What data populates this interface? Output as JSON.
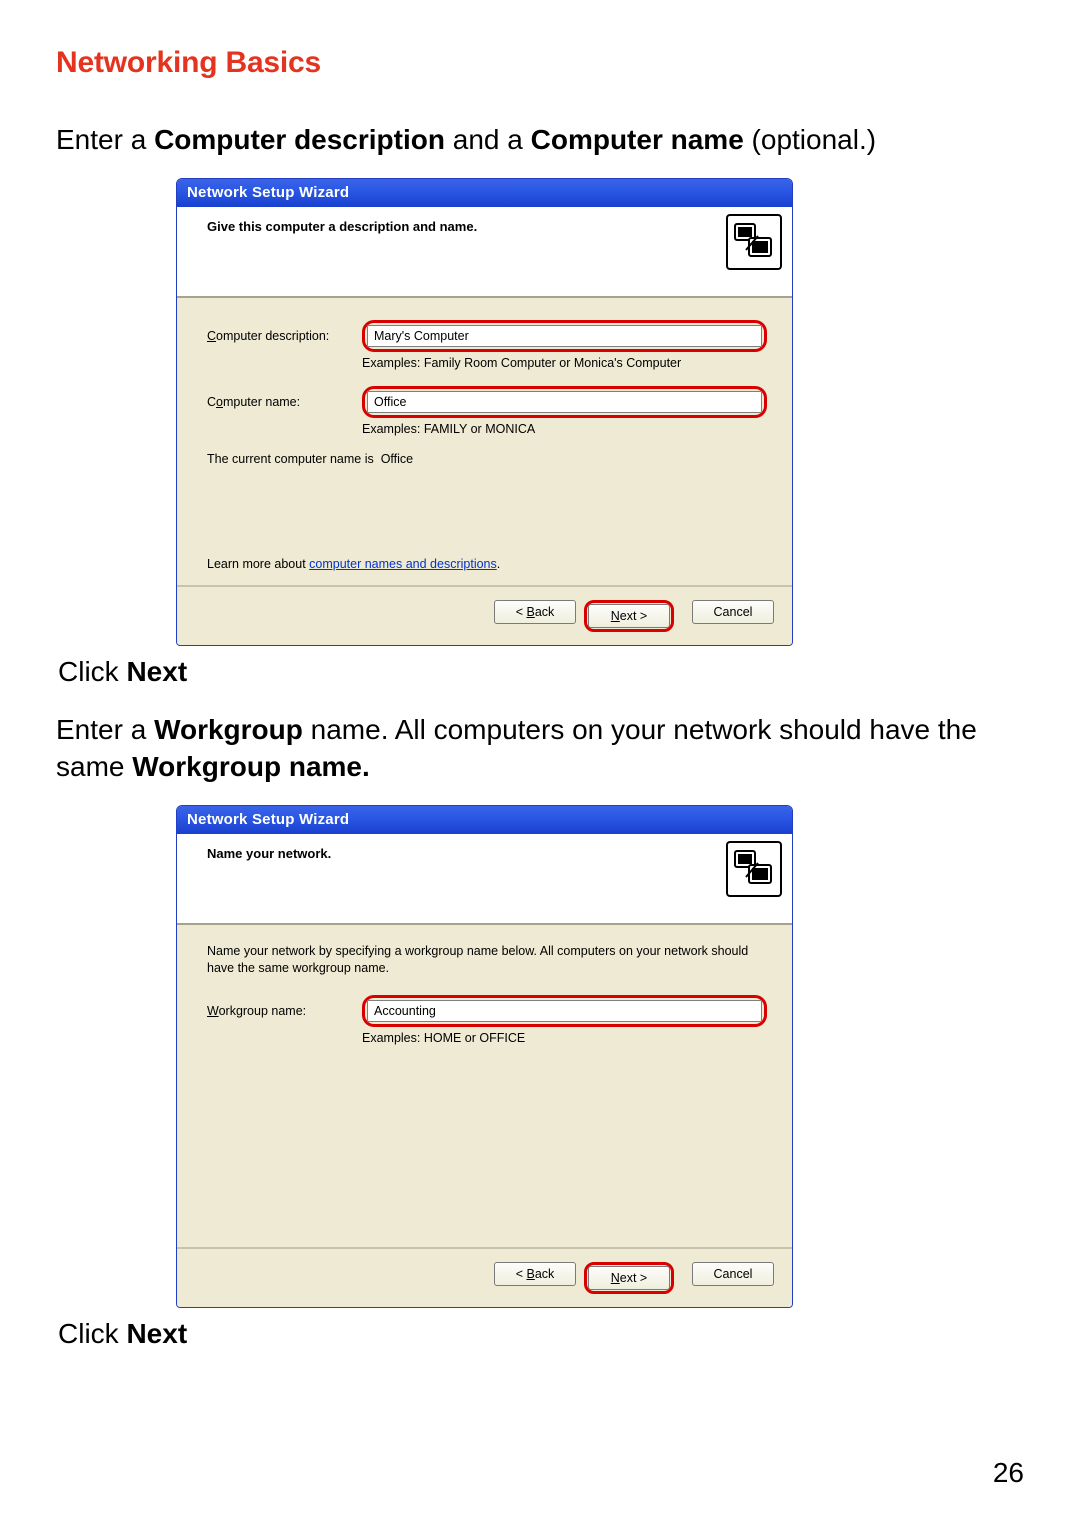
{
  "heading": "Networking Basics",
  "instruction1_parts": {
    "a": "Enter a ",
    "b": "Computer description",
    "c": " and a ",
    "d": "Computer name",
    "e": " (optional.)"
  },
  "click_next": {
    "a": "Click ",
    "b": "Next"
  },
  "instruction2_parts": {
    "a": "Enter a ",
    "b": "Workgroup",
    "c": " name.  All computers on your network should have the same ",
    "d": "Workgroup name."
  },
  "page_number": "26",
  "wizard1": {
    "title": "Network Setup Wizard",
    "head": "Give this computer a description and name.",
    "desc_label_pre": "C",
    "desc_label_post": "omputer description:",
    "desc_value": "Mary's Computer",
    "desc_example": "Examples: Family Room Computer or Monica's Computer",
    "name_label_pre": "C",
    "name_label_mid": "o",
    "name_label_post": "mputer name:",
    "name_value": "Office",
    "name_example": "Examples: FAMILY or MONICA",
    "current_prefix": "The current computer name is ",
    "current_value": "Office",
    "learn_prefix": "Learn more about ",
    "learn_link": "computer names and descriptions",
    "learn_suffix": ".",
    "back": "< Back",
    "next": "Next >",
    "cancel": "Cancel"
  },
  "wizard2": {
    "title": "Network Setup Wizard",
    "head": "Name your network.",
    "intro": "Name your network by specifying a workgroup name below. All computers on your network should have the same workgroup name.",
    "wg_label_pre": "W",
    "wg_label_post": "orkgroup name:",
    "wg_value": "Accounting",
    "wg_example": "Examples: HOME or OFFICE",
    "back": "< Back",
    "next": "Next >",
    "cancel": "Cancel"
  }
}
